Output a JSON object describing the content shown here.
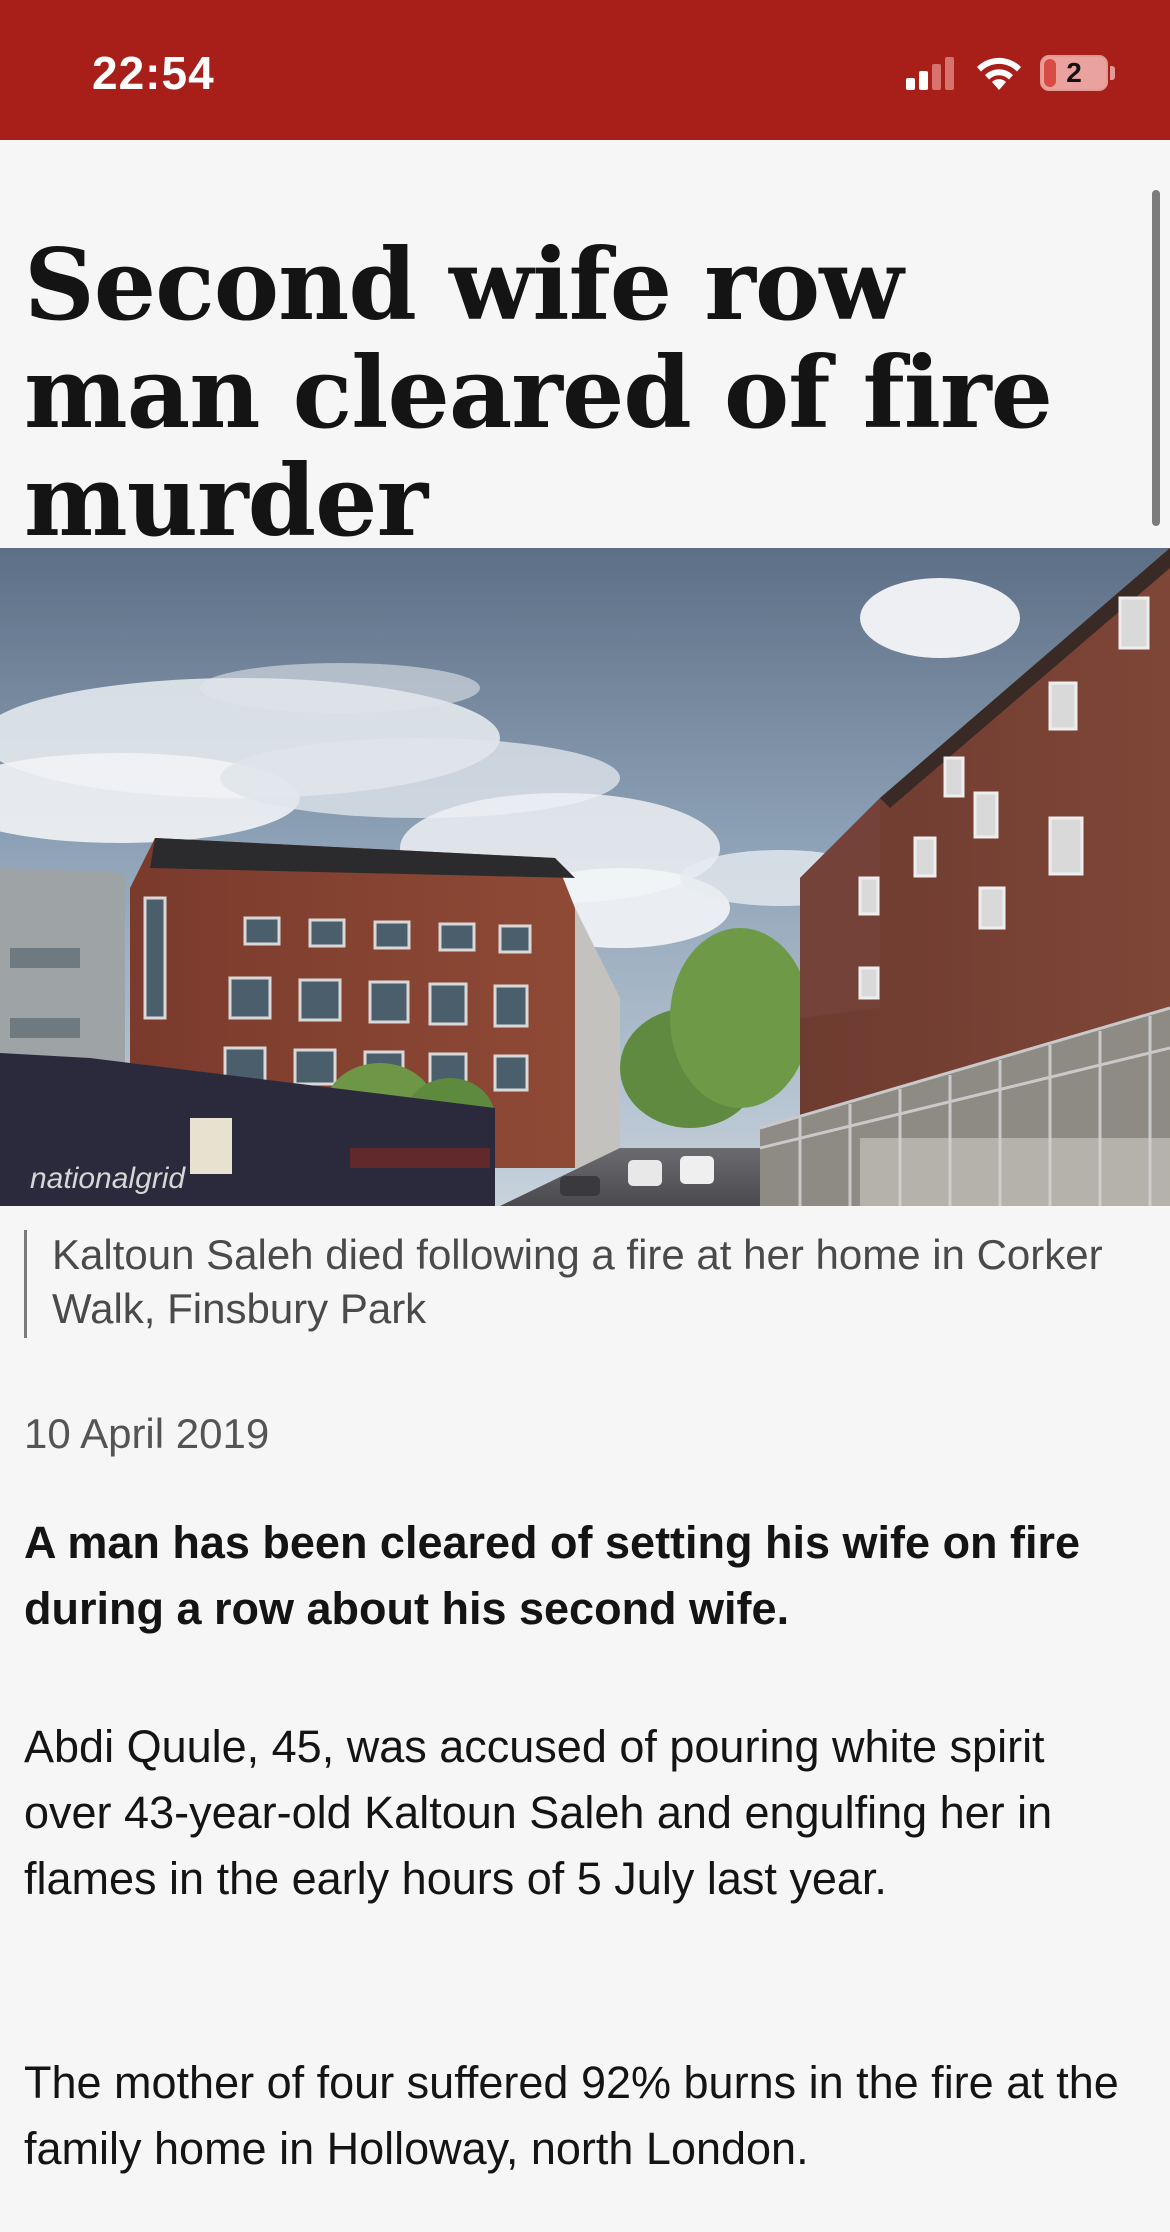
{
  "status_bar": {
    "time": "22:54",
    "battery_level": "2",
    "icons": [
      "signal-icon",
      "wifi-icon",
      "battery-icon"
    ],
    "background_color": "#a81f1a"
  },
  "article": {
    "headline": "Second wife row man cleared of fire murder",
    "image": {
      "caption": "Kaltoun Saleh died following a fire at her home in Corker Walk, Finsbury Park",
      "hoarding_text": "nationalgrid"
    },
    "date": "10 April 2019",
    "lead": "A man has been cleared of setting his wife on fire during a row about his second wife.",
    "paragraphs": [
      "Abdi Quule, 45, was accused of pouring white spirit over 43-year-old Kaltoun Saleh and engulfing her in flames in the early hours of 5 July last year.",
      "The mother of four suffered 92% burns in the fire at the family home in Holloway, north London."
    ]
  }
}
